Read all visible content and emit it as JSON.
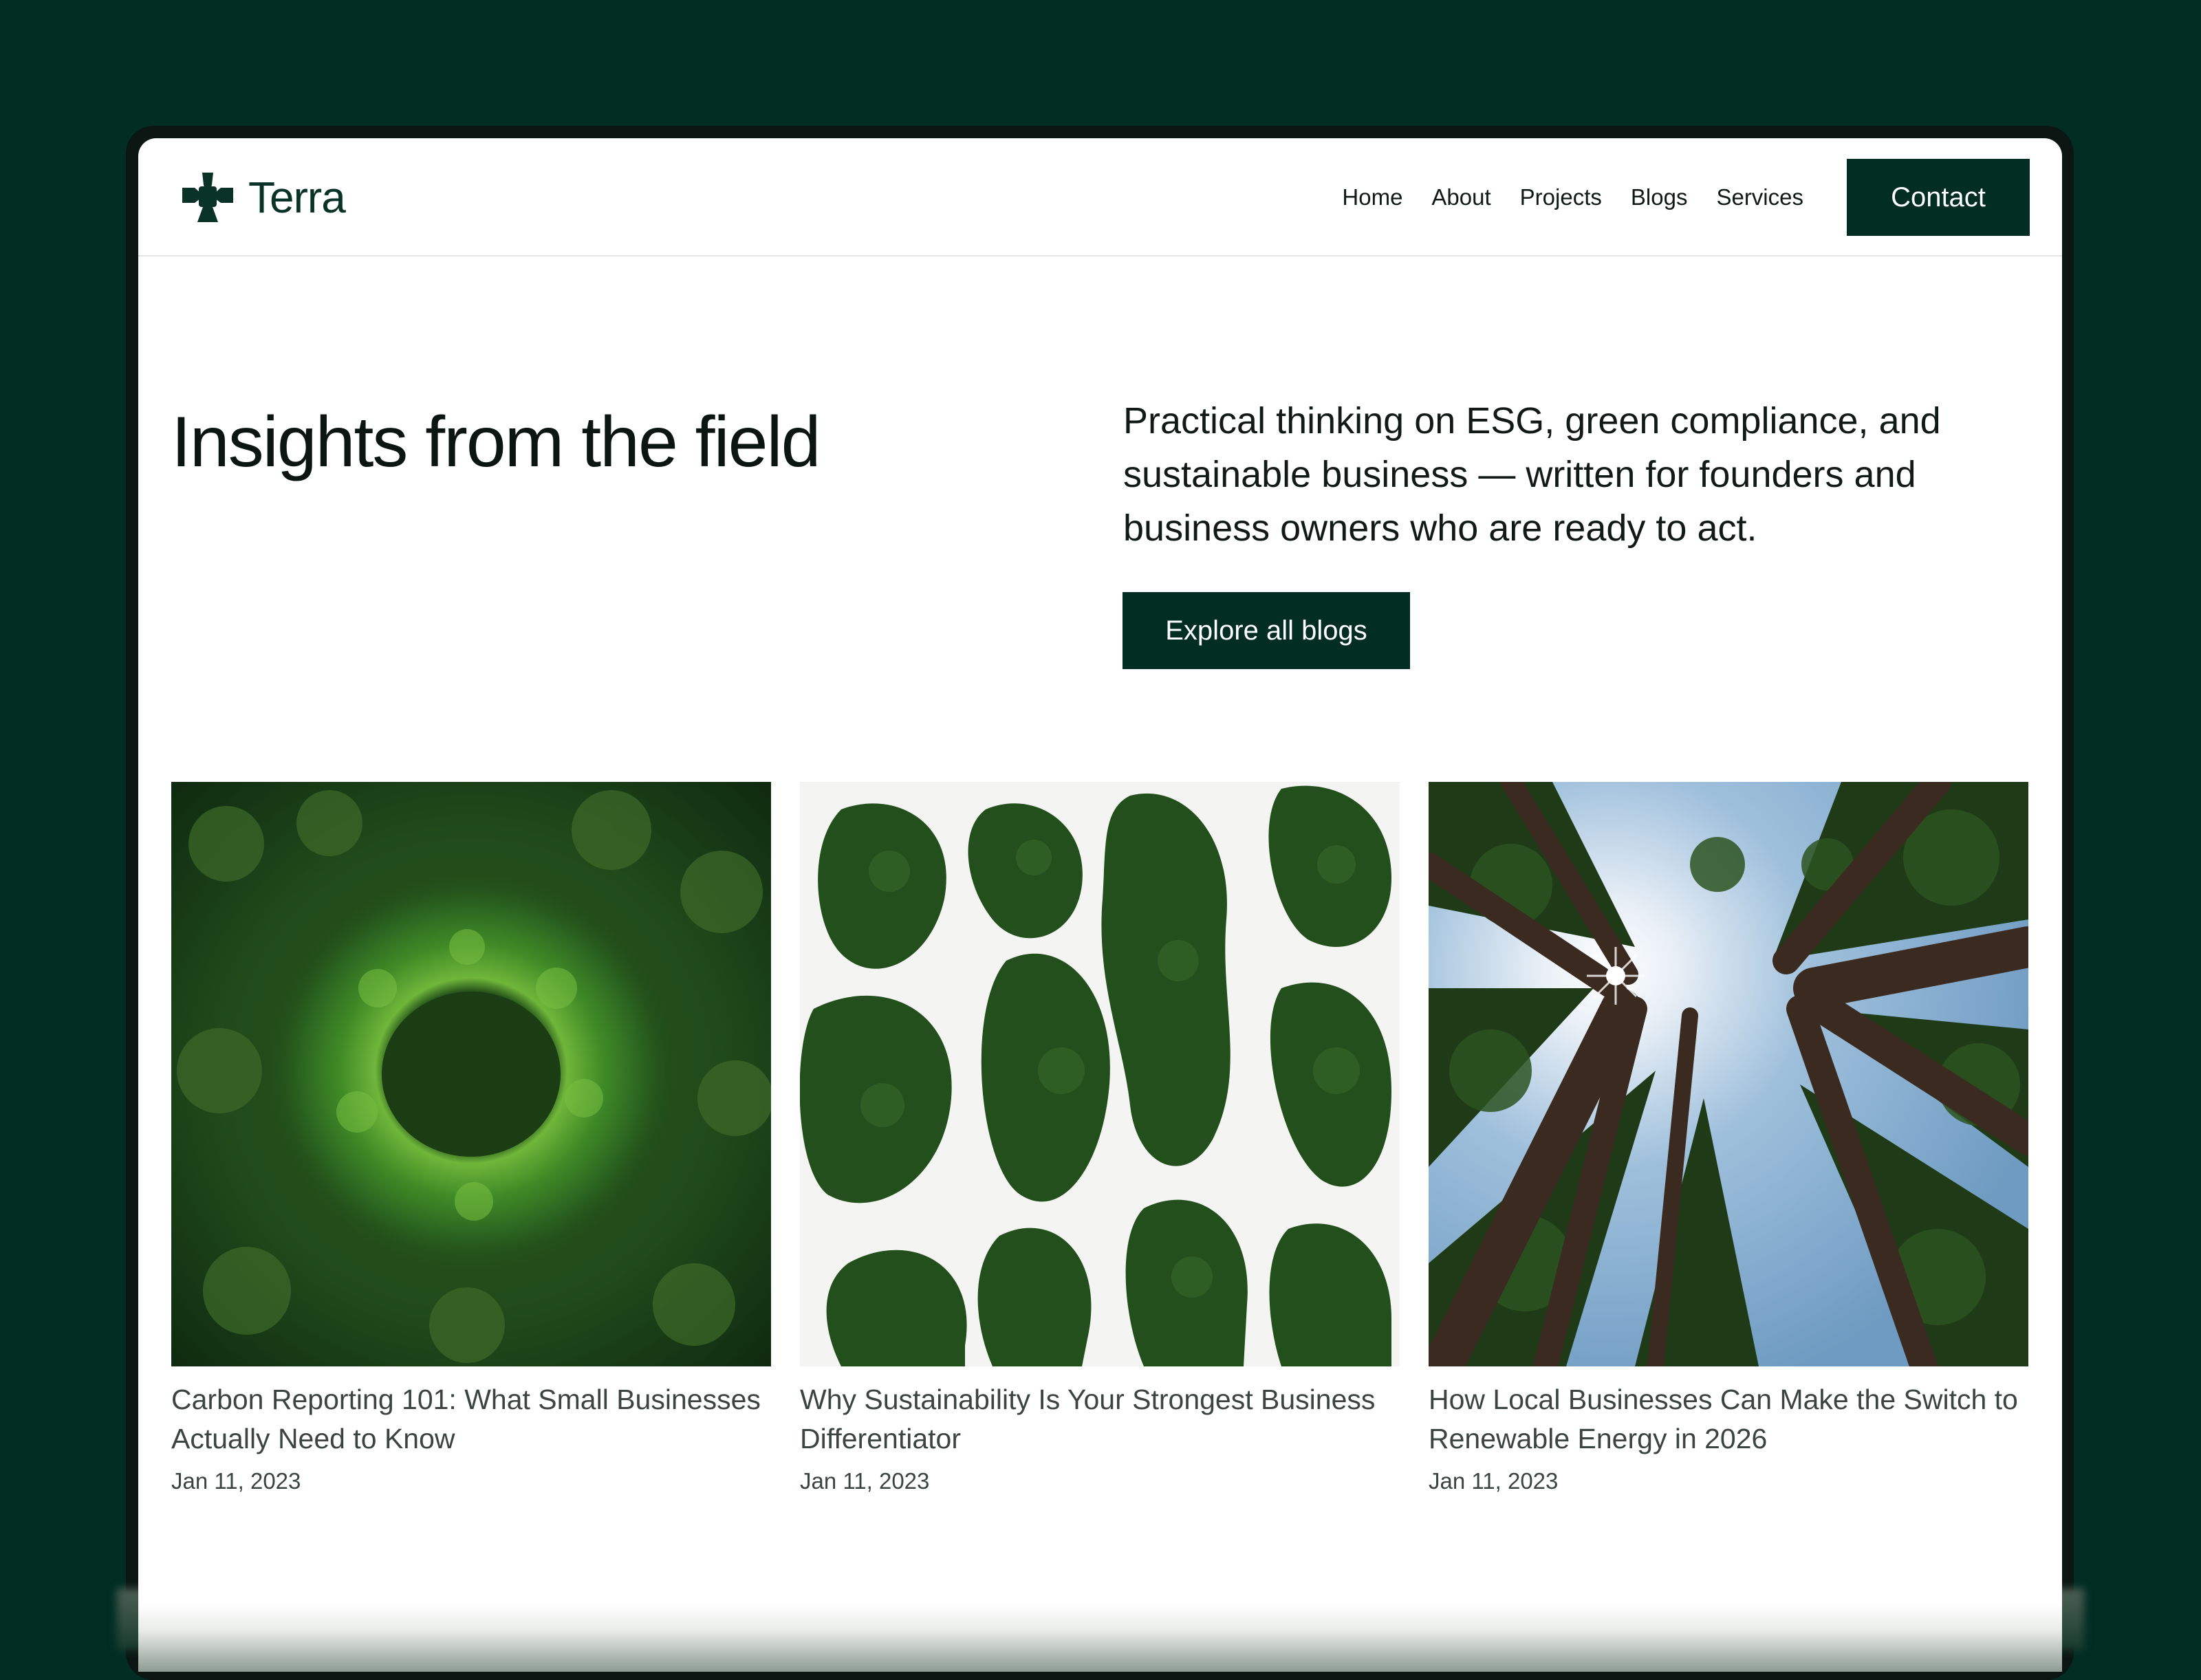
{
  "site": {
    "brand_name": "Terra",
    "brand_icon": "leaf-cross-icon",
    "colors": {
      "primary": "#012d22",
      "text": "#0b1512",
      "muted": "#3c4441",
      "background": "#ffffff"
    }
  },
  "nav": {
    "links": [
      {
        "label": "Home"
      },
      {
        "label": "About"
      },
      {
        "label": "Projects"
      },
      {
        "label": "Blogs"
      },
      {
        "label": "Services"
      }
    ],
    "contact_label": "Contact"
  },
  "hero": {
    "title": "Insights from the field",
    "description": "Practical thinking on ESG, green compliance,  and sustainable business — written for founders  and business owners who are ready to act.",
    "cta_label": "Explore all blogs"
  },
  "posts": [
    {
      "title": "Carbon Reporting 101: What Small Businesses Actually Need to Know",
      "date": "Jan 11, 2023",
      "image": "forest-ring-aerial"
    },
    {
      "title": "Why Sustainability Is Your Strongest Business Differentiator",
      "date": "Jan 11, 2023",
      "image": "tree-clusters-aerial"
    },
    {
      "title": "How Local Businesses Can Make the Switch to Renewable Energy in 2026",
      "date": "Jan 11, 2023",
      "image": "forest-canopy-looking-up"
    }
  ]
}
